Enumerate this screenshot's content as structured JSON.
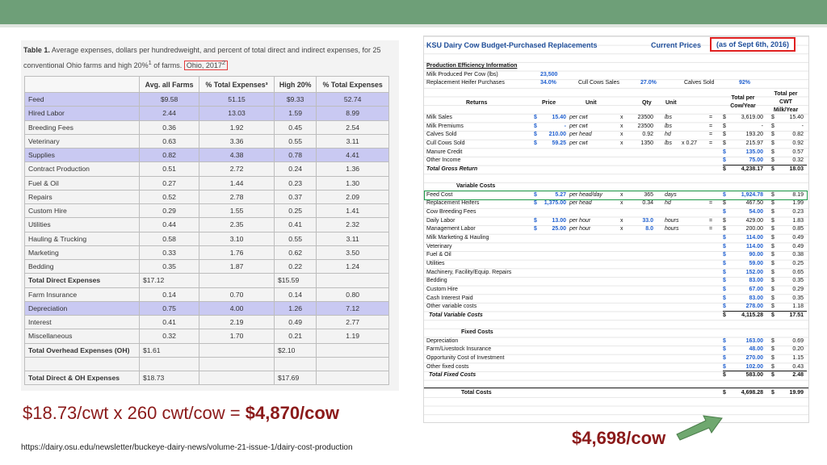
{
  "left_table": {
    "caption_bold": "Table 1.",
    "caption_text": "Average expenses, dollars per hundredweight, and percent of total direct and indirect expenses, for 25 conventional Ohio farms and high 20%",
    "caption_sup": "1",
    "caption_tail": " of farms.",
    "caption_highlight": "Ohio, 2017",
    "caption_highlight_sup": "2",
    "columns": [
      "",
      "Avg. all Farms",
      "% Total Expenses³",
      "High 20%",
      "% Total Expenses"
    ],
    "rows": [
      {
        "label": "Feed",
        "avg": "$9.58",
        "pct_avg": "51.15",
        "high": "$9.33",
        "pct_high": "52.74",
        "highlight": true,
        "bold": false
      },
      {
        "label": "Hired Labor",
        "avg": "2.44",
        "pct_avg": "13.03",
        "high": "1.59",
        "pct_high": "8.99",
        "highlight": true,
        "bold": false
      },
      {
        "label": "Breeding Fees",
        "avg": "0.36",
        "pct_avg": "1.92",
        "high": "0.45",
        "pct_high": "2.54",
        "highlight": false,
        "bold": false
      },
      {
        "label": "Veterinary",
        "avg": "0.63",
        "pct_avg": "3.36",
        "high": "0.55",
        "pct_high": "3.11",
        "highlight": false,
        "bold": false
      },
      {
        "label": "Supplies",
        "avg": "0.82",
        "pct_avg": "4.38",
        "high": "0.78",
        "pct_high": "4.41",
        "highlight": true,
        "bold": false
      },
      {
        "label": "Contract Production",
        "avg": "0.51",
        "pct_avg": "2.72",
        "high": "0.24",
        "pct_high": "1.36",
        "highlight": false,
        "bold": false
      },
      {
        "label": "Fuel & Oil",
        "avg": "0.27",
        "pct_avg": "1.44",
        "high": "0.23",
        "pct_high": "1.30",
        "highlight": false,
        "bold": false
      },
      {
        "label": "Repairs",
        "avg": "0.52",
        "pct_avg": "2.78",
        "high": "0.37",
        "pct_high": "2.09",
        "highlight": false,
        "bold": false
      },
      {
        "label": "Custom Hire",
        "avg": "0.29",
        "pct_avg": "1.55",
        "high": "0.25",
        "pct_high": "1.41",
        "highlight": false,
        "bold": false
      },
      {
        "label": "Utilities",
        "avg": "0.44",
        "pct_avg": "2.35",
        "high": "0.41",
        "pct_high": "2.32",
        "highlight": false,
        "bold": false
      },
      {
        "label": "Hauling & Trucking",
        "avg": "0.58",
        "pct_avg": "3.10",
        "high": "0.55",
        "pct_high": "3.11",
        "highlight": false,
        "bold": false
      },
      {
        "label": "Marketing",
        "avg": "0.33",
        "pct_avg": "1.76",
        "high": "0.62",
        "pct_high": "3.50",
        "highlight": false,
        "bold": false
      },
      {
        "label": "Bedding",
        "avg": "0.35",
        "pct_avg": "1.87",
        "high": "0.22",
        "pct_high": "1.24",
        "highlight": false,
        "bold": false
      },
      {
        "label": "Total Direct Expenses",
        "avg": "$17.12",
        "pct_avg": "",
        "high": "$15.59",
        "pct_high": "",
        "highlight": false,
        "bold": true
      },
      {
        "label": "Farm Insurance",
        "avg": "0.14",
        "pct_avg": "0.70",
        "high": "0.14",
        "pct_high": "0.80",
        "highlight": false,
        "bold": false
      },
      {
        "label": "Depreciation",
        "avg": "0.75",
        "pct_avg": "4.00",
        "high": "1.26",
        "pct_high": "7.12",
        "highlight": true,
        "bold": false
      },
      {
        "label": "Interest",
        "avg": "0.41",
        "pct_avg": "2.19",
        "high": "0.49",
        "pct_high": "2.77",
        "highlight": false,
        "bold": false
      },
      {
        "label": "Miscellaneous",
        "avg": "0.32",
        "pct_avg": "1.70",
        "high": "0.21",
        "pct_high": "1.19",
        "highlight": false,
        "bold": false
      },
      {
        "label": "Total Overhead Expenses (OH)",
        "avg": "$1.61",
        "pct_avg": "",
        "high": "$2.10",
        "pct_high": "",
        "highlight": false,
        "bold": true
      },
      {
        "label": "",
        "avg": "",
        "pct_avg": "",
        "high": "",
        "pct_high": "",
        "highlight": false,
        "bold": false
      },
      {
        "label": "Total Direct & OH Expenses",
        "avg": "$18.73",
        "pct_avg": "",
        "high": "$17.69",
        "pct_high": "",
        "highlight": false,
        "bold": true
      }
    ]
  },
  "formula_text": "$18.73/cwt x 260 cwt/cow = ",
  "formula_result": "$4,870/cow",
  "source_url": "https://dairy.osu.edu/newsletter/buckeye-dairy-news/volume-21-issue-1/dairy-cost-production",
  "budget": {
    "title": "KSU Dairy Cow Budget-Purchased Replacements",
    "current_prices": "Current Prices",
    "date_label": "(as of Sept 6th, 2016)",
    "efficiency_header": "Production Efficiency Information",
    "milk_per_cow_label": "Milk Produced Per Cow (lbs)",
    "milk_per_cow_value": "23,500",
    "replacement_label": "Replacement Heifer Purchases",
    "replacement_value": "34.0%",
    "cull_label": "Cull Cows Sales",
    "cull_value": "27.0%",
    "calves_label": "Calves Sold",
    "calves_value": "92%",
    "headers": {
      "returns": "Returns",
      "price": "Price",
      "unit": "Unit",
      "qty": "Qty",
      "unit2": "Unit",
      "total_per_cow": "Total per Cow/Year",
      "total_per_cwt": "Total per CWT Milk/Year"
    },
    "returns_rows": [
      {
        "label": "Milk Sales",
        "dollar": "$",
        "price": "15.40",
        "unit": "per cwt",
        "x": "x",
        "qty": "23500",
        "unit2": "lbs",
        "mult": "",
        "eq": "=",
        "total": "3,619.00",
        "cwt": "15.40",
        "total_blue": false
      },
      {
        "label": "Milk Premiums",
        "dollar": "$",
        "price": "-",
        "unit": "per cwt",
        "x": "x",
        "qty": "23500",
        "unit2": "lbs",
        "mult": "",
        "eq": "=",
        "total": "-",
        "cwt": "-",
        "total_blue": false
      },
      {
        "label": "Calves Sold",
        "dollar": "$",
        "price": "210.00",
        "unit": "per head",
        "x": "x",
        "qty": "0.92",
        "unit2": "hd",
        "mult": "",
        "eq": "=",
        "total": "193.20",
        "cwt": "0.82",
        "total_blue": false
      },
      {
        "label": "Cull Cows Sold",
        "dollar": "$",
        "price": "59.25",
        "unit": "per cwt",
        "x": "x",
        "qty": "1350",
        "unit2": "lbs",
        "mult": "x  0.27",
        "eq": "=",
        "total": "215.97",
        "cwt": "0.92",
        "total_blue": false
      },
      {
        "label": "Manure Credit",
        "dollar": "",
        "price": "",
        "unit": "",
        "x": "",
        "qty": "",
        "unit2": "",
        "mult": "",
        "eq": "",
        "total": "135.00",
        "cwt": "0.57",
        "total_blue": true
      },
      {
        "label": "Other Income",
        "dollar": "",
        "price": "",
        "unit": "",
        "x": "",
        "qty": "",
        "unit2": "",
        "mult": "",
        "eq": "",
        "total": "75.00",
        "cwt": "0.32",
        "total_blue": true
      }
    ],
    "gross_return_label": "Total Gross Return",
    "gross_return_total": "4,238.17",
    "gross_return_cwt": "18.03",
    "variable_header": "Variable Costs",
    "variable_rows": [
      {
        "label": "Feed Cost",
        "dollar": "$",
        "price": "5.27",
        "unit": "per head/day",
        "x": "x",
        "qty": "365",
        "unit2": "days",
        "eq": "",
        "total": "1,924.78",
        "cwt": "8.19",
        "total_blue": true,
        "qty_blue": false
      },
      {
        "label": "Replacement Heifers",
        "dollar": "$",
        "price": "1,375.00",
        "unit": "per head",
        "x": "x",
        "qty": "0.34",
        "unit2": "hd",
        "eq": "=",
        "total": "467.50",
        "cwt": "1.99",
        "total_blue": false,
        "qty_blue": false
      },
      {
        "label": "Cow Breeding Fees",
        "dollar": "",
        "price": "",
        "unit": "",
        "x": "",
        "qty": "",
        "unit2": "",
        "eq": "",
        "total": "54.00",
        "cwt": "0.23",
        "total_blue": true,
        "qty_blue": false
      },
      {
        "label": "Daily Labor",
        "dollar": "$",
        "price": "13.00",
        "unit": "per hour",
        "x": "x",
        "qty": "33.0",
        "unit2": "hours",
        "eq": "=",
        "total": "429.00",
        "cwt": "1.83",
        "total_blue": false,
        "qty_blue": true
      },
      {
        "label": "Management Labor",
        "dollar": "$",
        "price": "25.00",
        "unit": "per hour",
        "x": "x",
        "qty": "8.0",
        "unit2": "hours",
        "eq": "=",
        "total": "200.00",
        "cwt": "0.85",
        "total_blue": false,
        "qty_blue": true
      },
      {
        "label": "Milk Marketing & Hauling",
        "dollar": "",
        "price": "",
        "unit": "",
        "x": "",
        "qty": "",
        "unit2": "",
        "eq": "",
        "total": "114.00",
        "cwt": "0.49",
        "total_blue": true,
        "qty_blue": false
      },
      {
        "label": "Veterinary",
        "dollar": "",
        "price": "",
        "unit": "",
        "x": "",
        "qty": "",
        "unit2": "",
        "eq": "",
        "total": "114.00",
        "cwt": "0.49",
        "total_blue": true,
        "qty_blue": false
      },
      {
        "label": "Fuel & Oil",
        "dollar": "",
        "price": "",
        "unit": "",
        "x": "",
        "qty": "",
        "unit2": "",
        "eq": "",
        "total": "90.00",
        "cwt": "0.38",
        "total_blue": true,
        "qty_blue": false
      },
      {
        "label": "Utilities",
        "dollar": "",
        "price": "",
        "unit": "",
        "x": "",
        "qty": "",
        "unit2": "",
        "eq": "",
        "total": "59.00",
        "cwt": "0.25",
        "total_blue": true,
        "qty_blue": false
      },
      {
        "label": "Machinery, Facility/Equip. Repairs",
        "dollar": "",
        "price": "",
        "unit": "",
        "x": "",
        "qty": "",
        "unit2": "",
        "eq": "",
        "total": "152.00",
        "cwt": "0.65",
        "total_blue": true,
        "qty_blue": false
      },
      {
        "label": "Bedding",
        "dollar": "",
        "price": "",
        "unit": "",
        "x": "",
        "qty": "",
        "unit2": "",
        "eq": "",
        "total": "83.00",
        "cwt": "0.35",
        "total_blue": true,
        "qty_blue": false
      },
      {
        "label": "Custom Hire",
        "dollar": "",
        "price": "",
        "unit": "",
        "x": "",
        "qty": "",
        "unit2": "",
        "eq": "",
        "total": "67.00",
        "cwt": "0.29",
        "total_blue": true,
        "qty_blue": false
      },
      {
        "label": "Cash Interest Paid",
        "dollar": "",
        "price": "",
        "unit": "",
        "x": "",
        "qty": "",
        "unit2": "",
        "eq": "",
        "total": "83.00",
        "cwt": "0.35",
        "total_blue": true,
        "qty_blue": false
      },
      {
        "label": "Other variable costs",
        "dollar": "",
        "price": "",
        "unit": "",
        "x": "",
        "qty": "",
        "unit2": "",
        "eq": "",
        "total": "278.00",
        "cwt": "1.18",
        "total_blue": true,
        "qty_blue": false
      }
    ],
    "total_variable_label": "Total Variable Costs",
    "total_variable_total": "4,115.28",
    "total_variable_cwt": "17.51",
    "fixed_header": "Fixed Costs",
    "fixed_rows": [
      {
        "label": "Depreciation",
        "total": "163.00",
        "cwt": "0.69"
      },
      {
        "label": "Farm/Livestock Insurance",
        "total": "48.00",
        "cwt": "0.20"
      },
      {
        "label": "Opportunity Cost of Investment",
        "total": "270.00",
        "cwt": "1.15"
      },
      {
        "label": "Other fixed costs",
        "total": "102.00",
        "cwt": "0.43"
      }
    ],
    "total_fixed_label": "Total Fixed Costs",
    "total_fixed_total": "583.00",
    "total_fixed_cwt": "2.48",
    "total_costs_label": "Total Costs",
    "total_costs_total": "4,698.28",
    "total_costs_cwt": "19.99"
  },
  "result_note": "$4,698/cow",
  "colors": {
    "banner": "#6e9f78",
    "highlight_row": "#c9c9f2",
    "emphasis_red": "#8b1a1a",
    "box_red": "#e02020",
    "spreadsheet_blue": "#1f5fcf",
    "arrow_green": "#6fa86f"
  }
}
